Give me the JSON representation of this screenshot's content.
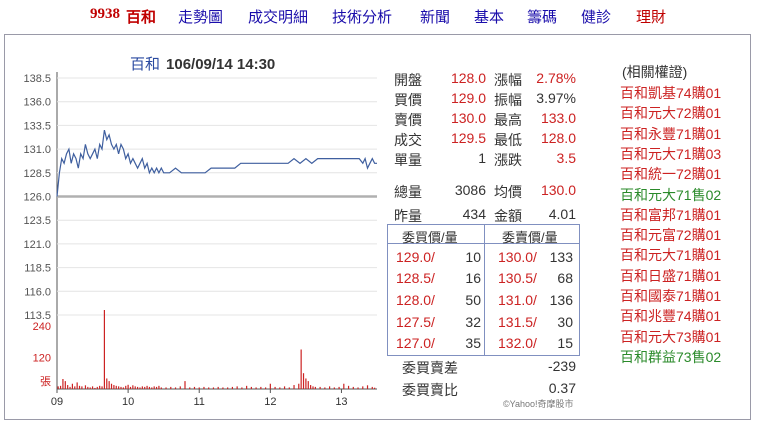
{
  "nav": {
    "code": "9938",
    "name": "百和",
    "links": [
      "走勢圖",
      "成交明細",
      "技術分析",
      "新聞",
      "基本",
      "籌碼",
      "健診",
      "理財"
    ]
  },
  "chart_title": {
    "stock": "百和",
    "datetime": "106/09/14 14:30"
  },
  "quote": {
    "open_label": "開盤",
    "open": "128.0",
    "change_pct_label": "漲幅",
    "change_pct": "2.78%",
    "bid_label": "買價",
    "bid": "129.0",
    "amplitude_label": "振幅",
    "amplitude": "3.97%",
    "ask_label": "賣價",
    "ask": "130.0",
    "high_label": "最高",
    "high": "133.0",
    "last_label": "成交",
    "last": "129.5",
    "low_label": "最低",
    "low": "128.0",
    "unit_vol_label": "單量",
    "unit_vol": "1",
    "change_label": "漲跌",
    "change": "3.5",
    "total_vol_label": "總量",
    "total_vol": "3086",
    "avg_label": "均價",
    "avg": "130.0",
    "prev_vol_label": "昨量",
    "prev_vol": "434",
    "amount_label": "金額",
    "amount": "4.01"
  },
  "order_book": {
    "bid_header": "委買價/量",
    "ask_header": "委賣價/量",
    "bids": [
      {
        "price": "129.0/",
        "qty": "10"
      },
      {
        "price": "128.5/",
        "qty": "16"
      },
      {
        "price": "128.0/",
        "qty": "50"
      },
      {
        "price": "127.5/",
        "qty": "32"
      },
      {
        "price": "127.0/",
        "qty": "35"
      }
    ],
    "asks": [
      {
        "price": "130.0/",
        "qty": "133"
      },
      {
        "price": "130.5/",
        "qty": "68"
      },
      {
        "price": "131.0/",
        "qty": "136"
      },
      {
        "price": "131.5/",
        "qty": "30"
      },
      {
        "price": "132.0/",
        "qty": "15"
      }
    ],
    "diff_label": "委買賣差",
    "diff": "-239",
    "ratio_label": "委買賣比",
    "ratio": "0.37"
  },
  "copyright": "©Yahoo!奇摩股市",
  "warrants": {
    "title": "(相關權證)",
    "items": [
      {
        "label": "百和凱基74購01",
        "color": "#cc2222"
      },
      {
        "label": "百和元大72購01",
        "color": "#cc2222"
      },
      {
        "label": "百和永豐71購01",
        "color": "#cc2222"
      },
      {
        "label": "百和元大71購03",
        "color": "#cc2222"
      },
      {
        "label": "百和統一72購01",
        "color": "#cc2222"
      },
      {
        "label": "百和元大71售02",
        "color": "#2a8a2a"
      },
      {
        "label": "百和富邦71購01",
        "color": "#cc2222"
      },
      {
        "label": "百和元富72購01",
        "color": "#cc2222"
      },
      {
        "label": "百和元大71購01",
        "color": "#cc2222"
      },
      {
        "label": "百和日盛71購01",
        "color": "#cc2222"
      },
      {
        "label": "百和國泰71購01",
        "color": "#cc2222"
      },
      {
        "label": "百和兆豐74購01",
        "color": "#cc2222"
      },
      {
        "label": "百和元大73購01",
        "color": "#cc2222"
      },
      {
        "label": "百和群益73售02",
        "color": "#2a8a2a"
      }
    ]
  },
  "chart_data": {
    "type": "line",
    "y_ticks": [
      "138.5",
      "136.0",
      "133.5",
      "131.0",
      "128.5",
      "126.0",
      "123.5",
      "121.0",
      "118.5",
      "116.0",
      "113.5"
    ],
    "ylim": [
      113.5,
      138.5
    ],
    "x_ticks": [
      "09",
      "10",
      "11",
      "12",
      "13"
    ],
    "xlim": [
      0,
      270
    ],
    "reference_price": 126.0,
    "line_color": "#3f5f9f",
    "reference_color": "#b0b0b0",
    "price_series": [
      [
        0,
        126.0
      ],
      [
        2,
        128.5
      ],
      [
        4,
        130.0
      ],
      [
        6,
        129.5
      ],
      [
        8,
        130.5
      ],
      [
        10,
        131.0
      ],
      [
        12,
        129.5
      ],
      [
        14,
        130.5
      ],
      [
        16,
        130.0
      ],
      [
        18,
        129.0
      ],
      [
        20,
        130.5
      ],
      [
        22,
        130.0
      ],
      [
        24,
        131.5
      ],
      [
        26,
        130.5
      ],
      [
        28,
        130.0
      ],
      [
        30,
        130.5
      ],
      [
        32,
        131.0
      ],
      [
        34,
        130.0
      ],
      [
        36,
        131.5
      ],
      [
        38,
        131.0
      ],
      [
        40,
        133.0
      ],
      [
        42,
        132.0
      ],
      [
        44,
        132.5
      ],
      [
        46,
        131.5
      ],
      [
        48,
        131.0
      ],
      [
        50,
        131.5
      ],
      [
        52,
        130.5
      ],
      [
        54,
        131.5
      ],
      [
        56,
        131.0
      ],
      [
        58,
        130.0
      ],
      [
        60,
        130.5
      ],
      [
        62,
        129.5
      ],
      [
        64,
        130.0
      ],
      [
        66,
        129.5
      ],
      [
        68,
        129.0
      ],
      [
        70,
        129.5
      ],
      [
        72,
        130.0
      ],
      [
        74,
        129.0
      ],
      [
        76,
        129.5
      ],
      [
        78,
        128.5
      ],
      [
        80,
        129.0
      ],
      [
        82,
        128.5
      ],
      [
        84,
        129.0
      ],
      [
        86,
        128.5
      ],
      [
        88,
        129.0
      ],
      [
        90,
        128.5
      ],
      [
        95,
        128.5
      ],
      [
        100,
        129.0
      ],
      [
        105,
        128.5
      ],
      [
        110,
        128.5
      ],
      [
        115,
        128.5
      ],
      [
        120,
        128.5
      ],
      [
        125,
        128.5
      ],
      [
        130,
        129.0
      ],
      [
        135,
        129.0
      ],
      [
        140,
        129.0
      ],
      [
        145,
        129.0
      ],
      [
        150,
        129.0
      ],
      [
        155,
        129.5
      ],
      [
        160,
        129.5
      ],
      [
        165,
        129.5
      ],
      [
        170,
        129.5
      ],
      [
        175,
        129.5
      ],
      [
        180,
        129.5
      ],
      [
        185,
        129.5
      ],
      [
        190,
        129.5
      ],
      [
        195,
        129.5
      ],
      [
        200,
        130.0
      ],
      [
        205,
        129.5
      ],
      [
        210,
        130.0
      ],
      [
        215,
        129.5
      ],
      [
        220,
        130.0
      ],
      [
        225,
        130.0
      ],
      [
        230,
        130.0
      ],
      [
        235,
        130.0
      ],
      [
        240,
        130.0
      ],
      [
        245,
        130.0
      ],
      [
        250,
        130.0
      ],
      [
        255,
        130.0
      ],
      [
        258,
        129.5
      ],
      [
        260,
        130.0
      ],
      [
        262,
        129.0
      ],
      [
        264,
        129.5
      ],
      [
        266,
        130.0
      ],
      [
        268,
        129.5
      ],
      [
        270,
        129.5
      ]
    ],
    "volume_ticks": [
      "240",
      "120",
      "張"
    ],
    "volume_ylim": [
      0,
      300
    ],
    "volume_color": "#cc2222",
    "volume_series": [
      [
        1,
        10
      ],
      [
        3,
        12
      ],
      [
        5,
        38
      ],
      [
        7,
        30
      ],
      [
        9,
        15
      ],
      [
        11,
        8
      ],
      [
        13,
        20
      ],
      [
        15,
        10
      ],
      [
        17,
        25
      ],
      [
        19,
        12
      ],
      [
        21,
        10
      ],
      [
        24,
        14
      ],
      [
        26,
        8
      ],
      [
        28,
        6
      ],
      [
        30,
        10
      ],
      [
        32,
        4
      ],
      [
        34,
        8
      ],
      [
        36,
        12
      ],
      [
        38,
        10
      ],
      [
        40,
        300
      ],
      [
        42,
        40
      ],
      [
        44,
        30
      ],
      [
        46,
        20
      ],
      [
        48,
        15
      ],
      [
        50,
        12
      ],
      [
        52,
        10
      ],
      [
        54,
        8
      ],
      [
        56,
        6
      ],
      [
        58,
        12
      ],
      [
        60,
        16
      ],
      [
        62,
        8
      ],
      [
        64,
        14
      ],
      [
        66,
        10
      ],
      [
        68,
        8
      ],
      [
        70,
        6
      ],
      [
        72,
        10
      ],
      [
        74,
        8
      ],
      [
        76,
        12
      ],
      [
        78,
        8
      ],
      [
        80,
        6
      ],
      [
        82,
        10
      ],
      [
        84,
        8
      ],
      [
        86,
        12
      ],
      [
        88,
        6
      ],
      [
        92,
        6
      ],
      [
        96,
        8
      ],
      [
        100,
        6
      ],
      [
        104,
        10
      ],
      [
        108,
        30
      ],
      [
        112,
        6
      ],
      [
        116,
        8
      ],
      [
        120,
        6
      ],
      [
        124,
        8
      ],
      [
        128,
        6
      ],
      [
        132,
        6
      ],
      [
        136,
        8
      ],
      [
        140,
        6
      ],
      [
        144,
        6
      ],
      [
        148,
        8
      ],
      [
        152,
        10
      ],
      [
        156,
        6
      ],
      [
        160,
        12
      ],
      [
        164,
        8
      ],
      [
        168,
        6
      ],
      [
        172,
        8
      ],
      [
        176,
        6
      ],
      [
        180,
        20
      ],
      [
        184,
        8
      ],
      [
        188,
        6
      ],
      [
        192,
        10
      ],
      [
        196,
        6
      ],
      [
        200,
        15
      ],
      [
        204,
        20
      ],
      [
        206,
        150
      ],
      [
        208,
        60
      ],
      [
        210,
        40
      ],
      [
        212,
        30
      ],
      [
        214,
        15
      ],
      [
        216,
        10
      ],
      [
        218,
        8
      ],
      [
        222,
        8
      ],
      [
        226,
        6
      ],
      [
        230,
        10
      ],
      [
        234,
        6
      ],
      [
        238,
        8
      ],
      [
        242,
        20
      ],
      [
        246,
        12
      ],
      [
        250,
        8
      ],
      [
        254,
        6
      ],
      [
        258,
        10
      ],
      [
        262,
        14
      ],
      [
        266,
        8
      ],
      [
        268,
        5
      ]
    ]
  }
}
